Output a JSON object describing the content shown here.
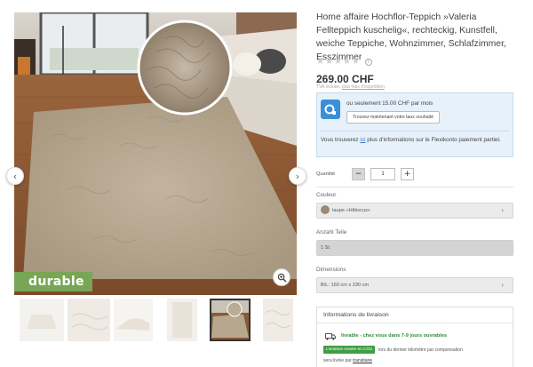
{
  "gallery": {
    "badge": "durable",
    "prev_arrow": "‹",
    "next_arrow": "›",
    "thumbnails": [
      {
        "name": "rug-flat-view"
      },
      {
        "name": "fur-closeup"
      },
      {
        "name": "rug-folded"
      },
      {
        "name": "rug-hanging"
      },
      {
        "name": "living-room-scene",
        "active": true
      },
      {
        "name": "fur-texture"
      }
    ]
  },
  "product": {
    "title": "Home affaire Hochflor-Teppich »Valeria Fellteppich kuschelig«, rechteckig, Kunstfell, weiche Teppiche, Wohnzimmer, Schlafzimmer, Esszimmer",
    "stars": [
      "★",
      "★",
      "★",
      "★",
      "★"
    ],
    "rating_info": "i",
    "price": "269.00 CHF",
    "vat_text": "TVA incluse,",
    "vat_link": "plus frais d'expédition"
  },
  "financing": {
    "line1": "ou seulement 15.00 CHF par mois",
    "button": "Trouvez maintenant votre taux souhaité",
    "more_prefix": "Vous trouverez ",
    "more_link": "ici",
    "more_suffix": " plus d'informations sur le Flexikonto paiement partiel."
  },
  "quantity": {
    "label": "Quantité",
    "minus": "−",
    "value": "1",
    "plus": "+"
  },
  "color": {
    "label": "Couleur",
    "value": "taupe »Hibiscus«",
    "chevron": "›"
  },
  "parts": {
    "label": "Anzahl Teile",
    "value": "1 St."
  },
  "dimensions": {
    "label": "Dimensions",
    "value": "B/L: 160 cm x 230 cm",
    "chevron": "›"
  },
  "delivery": {
    "heading": "Informations de livraison",
    "line": "livrable - chez vous dans 7-9 jours ouvrables",
    "eco_badge": "Livraison neutre en CO2",
    "eco_text": "lors du dernier kilomètre par compensation",
    "carrier_prefix": "sera livrée par ",
    "carrier_link": "transitaire"
  },
  "colors": {
    "badge_green": "#78a655",
    "finance_bg": "#e6f1fa",
    "link_blue": "#3b7ec0",
    "delivery_green": "#2e8b3a"
  }
}
